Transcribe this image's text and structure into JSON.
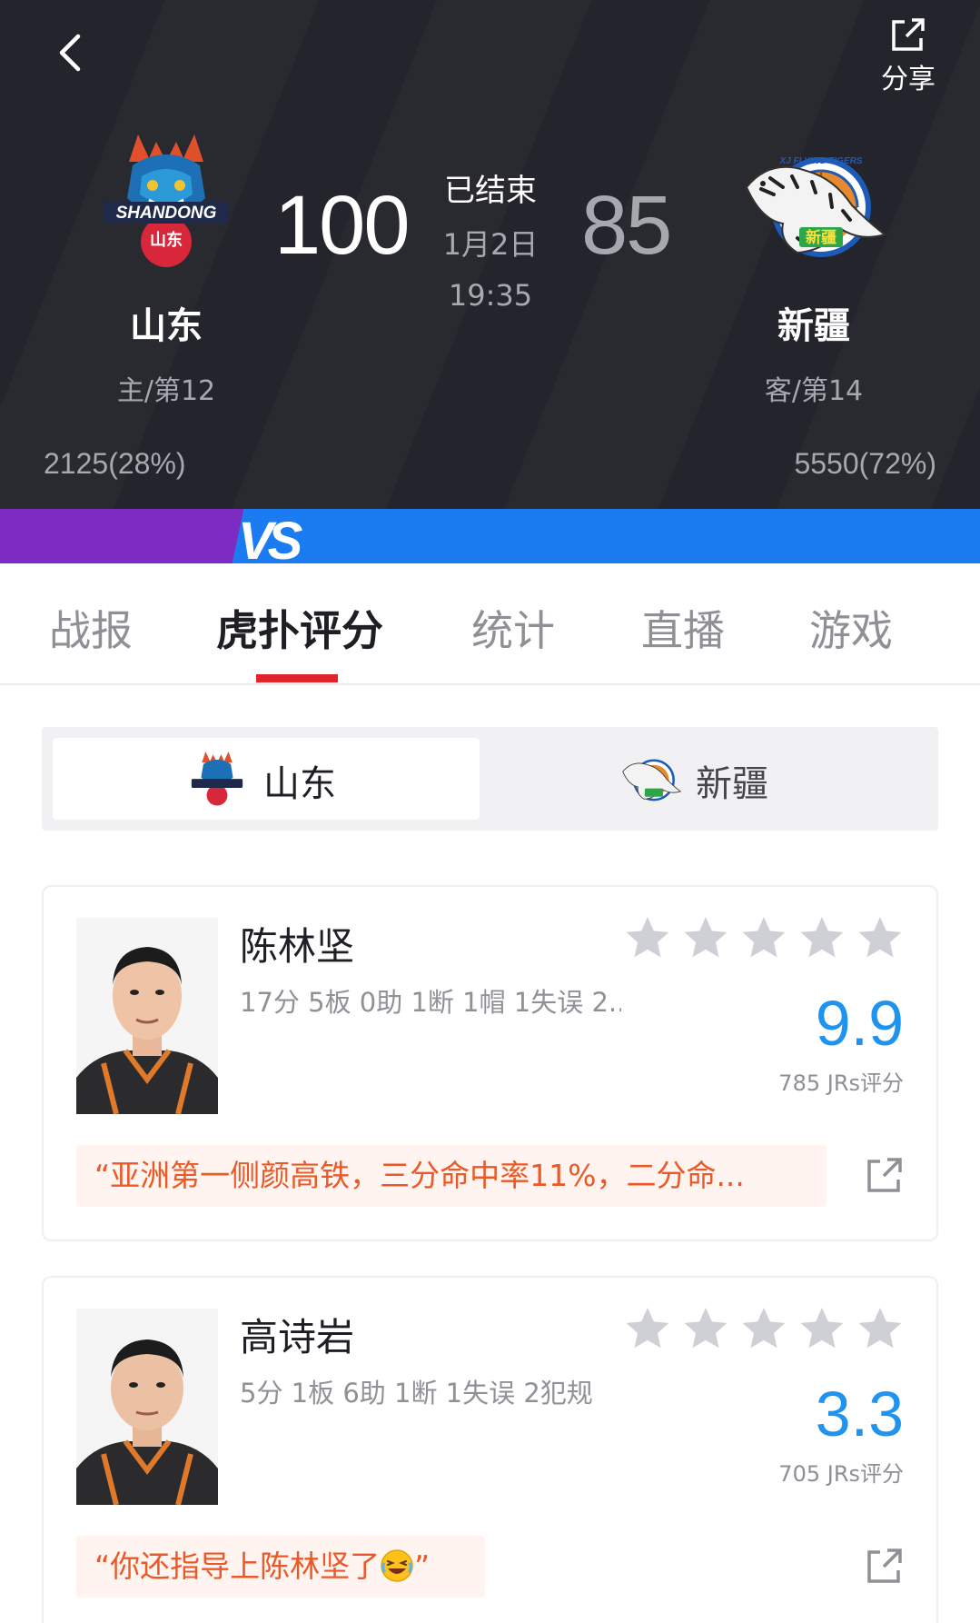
{
  "header": {
    "share_label": "分享",
    "status": "已结束",
    "date": "1月2日",
    "time": "19:35"
  },
  "home": {
    "name": "山东",
    "rank": "主/第12",
    "score": "100",
    "votes": "2125(28%)",
    "logo_text": "SHANDONG",
    "logo_sub": "山东"
  },
  "away": {
    "name": "新疆",
    "rank": "客/第14",
    "score": "85",
    "votes": "5550(72%)",
    "logo_text": "XJ FLYING TIGERS",
    "logo_sub": "新疆"
  },
  "vs_label": "VS",
  "tabs": [
    {
      "label": "战报",
      "active": false
    },
    {
      "label": "虎扑评分",
      "active": true
    },
    {
      "label": "统计",
      "active": false
    },
    {
      "label": "直播",
      "active": false
    },
    {
      "label": "游戏",
      "active": false
    }
  ],
  "team_switch": {
    "selected": "山东",
    "other": "新疆"
  },
  "players": [
    {
      "name": "陈林坚",
      "stats": "17分 5板 0助 1断 1帽 1失误 2...",
      "rating": "9.9",
      "rating_count": "785 JRs评分",
      "comment": "“亚洲第一侧颜高铁，三分命中率11%，二分命...",
      "stars_filled": 0,
      "stars_total": 5
    },
    {
      "name": "高诗岩",
      "stats": "5分 1板 6助 1断 1失误 2犯规",
      "rating": "3.3",
      "rating_count": "705 JRs评分",
      "comment_prefix": "“你还指导上陈林坚了",
      "comment_suffix": "”",
      "stars_filled": 0,
      "stars_total": 5
    }
  ],
  "colors": {
    "header_bg": "#24252c",
    "accent_red": "#e1242c",
    "rating_blue": "#1f93f0",
    "comment_orange": "#ea5a28",
    "vs_purple": "#7c2bc3",
    "vs_blue": "#1a7cf0"
  },
  "icons": {
    "back": "chevron-left-icon",
    "share": "share-icon",
    "star": "star-icon",
    "open": "external-link-icon",
    "emoji": "laughing-emoji-icon"
  }
}
